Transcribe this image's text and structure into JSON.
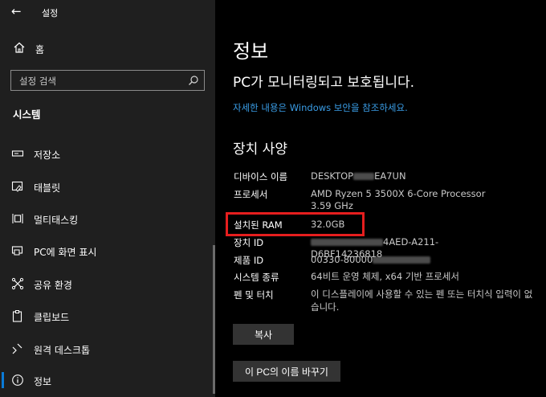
{
  "window": {
    "title": "설정"
  },
  "sidebar": {
    "home_label": "홈",
    "search_placeholder": "설정 검색",
    "section_title": "시스템",
    "items": [
      {
        "label": "저장소",
        "icon": "storage-icon"
      },
      {
        "label": "태블릿",
        "icon": "tablet-icon"
      },
      {
        "label": "멀티태스킹",
        "icon": "multitasking-icon"
      },
      {
        "label": "PC에 화면 표시",
        "icon": "projecting-icon"
      },
      {
        "label": "공유 환경",
        "icon": "shared-experiences-icon"
      },
      {
        "label": "클립보드",
        "icon": "clipboard-icon"
      },
      {
        "label": "원격 데스크톱",
        "icon": "remote-desktop-icon"
      },
      {
        "label": "정보",
        "icon": "info-icon",
        "selected": true
      }
    ]
  },
  "main": {
    "title": "정보",
    "protection_status": "PC가 모니터링되고 보호됩니다.",
    "security_link": "자세한 내용은 Windows 보안을 참조하세요.",
    "device_specs_title": "장치 사양",
    "specs": {
      "device_name": {
        "label": "디바이스 이름",
        "value_prefix": "DESKTOP",
        "value_suffix": "EA7UN"
      },
      "processor": {
        "label": "프로세서",
        "value_line1": "AMD Ryzen 5 3500X 6-Core Processor",
        "value_line2": "3.59 GHz"
      },
      "ram": {
        "label": "설치된 RAM",
        "value": "32.0GB"
      },
      "device_id": {
        "label": "장치 ID",
        "value_suffix": "4AED-A211-D6BF14236818"
      },
      "product_id": {
        "label": "제품 ID",
        "value_prefix": "00330-80000"
      },
      "system_type": {
        "label": "시스템 종류",
        "value": "64비트 운영 체제, x64 기반 프로세서"
      },
      "pen_touch": {
        "label": "펜 및 터치",
        "value": "이 디스플레이에 사용할 수 있는 펜 또는 터치식 입력이 없습니다."
      }
    },
    "copy_button": "복사",
    "rename_button": "이 PC의 이름 바꾸기"
  },
  "colors": {
    "accent": "#0a7bd8",
    "link": "#3a9de6",
    "highlight_box": "#e61e1e"
  }
}
